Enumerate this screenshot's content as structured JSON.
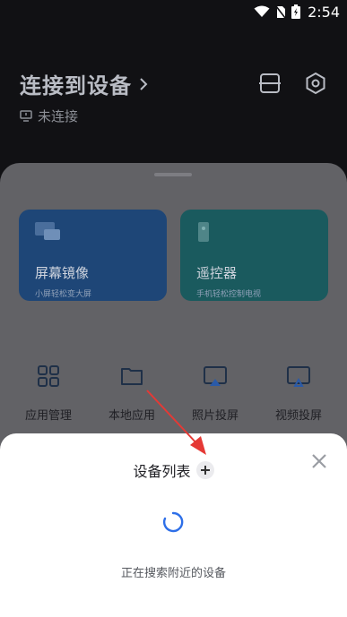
{
  "status_bar": {
    "time": "2:54"
  },
  "header": {
    "title": "连接到设备",
    "connection_status": "未连接"
  },
  "feature_cards": [
    {
      "title": "屏幕镜像",
      "subtitle": "小屏轻松变大屏"
    },
    {
      "title": "遥控器",
      "subtitle": "手机轻松控制电视"
    }
  ],
  "apps": [
    {
      "label": "应用管理",
      "icon": "grid-icon"
    },
    {
      "label": "本地应用",
      "icon": "folder-icon"
    },
    {
      "label": "照片投屏",
      "icon": "photo-cast-icon"
    },
    {
      "label": "视频投屏",
      "icon": "video-cast-icon"
    }
  ],
  "device_sheet": {
    "title": "设备列表",
    "searching_text": "正在搜索附近的设备"
  },
  "colors": {
    "accent_blue": "#2e6fe8",
    "annotation_red": "#e53935"
  }
}
